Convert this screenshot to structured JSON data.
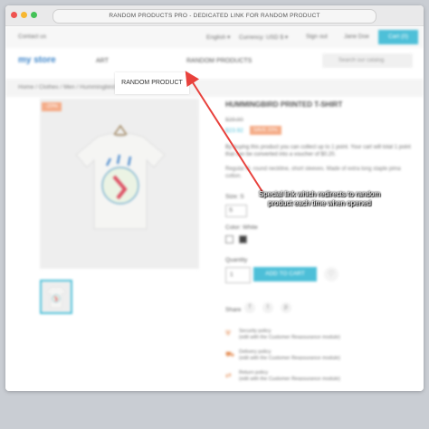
{
  "window": {
    "title": "RANDOM PRODUCTS PRO - DEDICATED LINK FOR RANDOM PRODUCT"
  },
  "topbar": {
    "contact": "Contact us",
    "language": "English ▾",
    "currency": "Currency: USD $ ▾",
    "sign_in": "Sign out",
    "account": "Jane Doe",
    "cart": "Cart (0)"
  },
  "header": {
    "logo": "my store",
    "menu_art": "ART",
    "menu_random": "RANDOM PRODUCT",
    "menu_random_products": "RANDOM PRODUCTS",
    "search_placeholder": "Search our catalog"
  },
  "breadcrumb": "Home  /  Clothes  /  Men  /  Hummingbird printed t-shirt",
  "product": {
    "discount_flag": "-20%",
    "title": "HUMMINGBIRD PRINTED T-SHIRT",
    "old_price": "$29.90",
    "price": "$23.92",
    "save_badge": "SAVE 20%",
    "loyalty": "By buying this product you can collect up to 1 point. Your cart will total 1 point that can be converted into a voucher of $0.20.",
    "description": "Regular fit, round neckline, short sleeves. Made of extra long staple pima cotton.",
    "size_label": "Size: S",
    "size_value": "S",
    "color_label": "Color: White",
    "quantity_label": "Quantity",
    "quantity_value": "1",
    "add_to_cart": "ADD TO CART",
    "share_label": "Share",
    "reassurance": [
      {
        "title": "Security policy",
        "sub": "(edit with the Customer Reassurance module)"
      },
      {
        "title": "Delivery policy",
        "sub": "(edit with the Customer Reassurance module)"
      },
      {
        "title": "Return policy",
        "sub": "(edit with the Customer Reassurance module)"
      }
    ]
  },
  "annotation": {
    "highlight_label": "RANDOM PRODUCT",
    "callout": "Special link which redirects to random product each time when opened"
  },
  "colors": {
    "accent": "#2fb5d2",
    "discount": "#f39d72",
    "arrow": "#e8413c"
  }
}
